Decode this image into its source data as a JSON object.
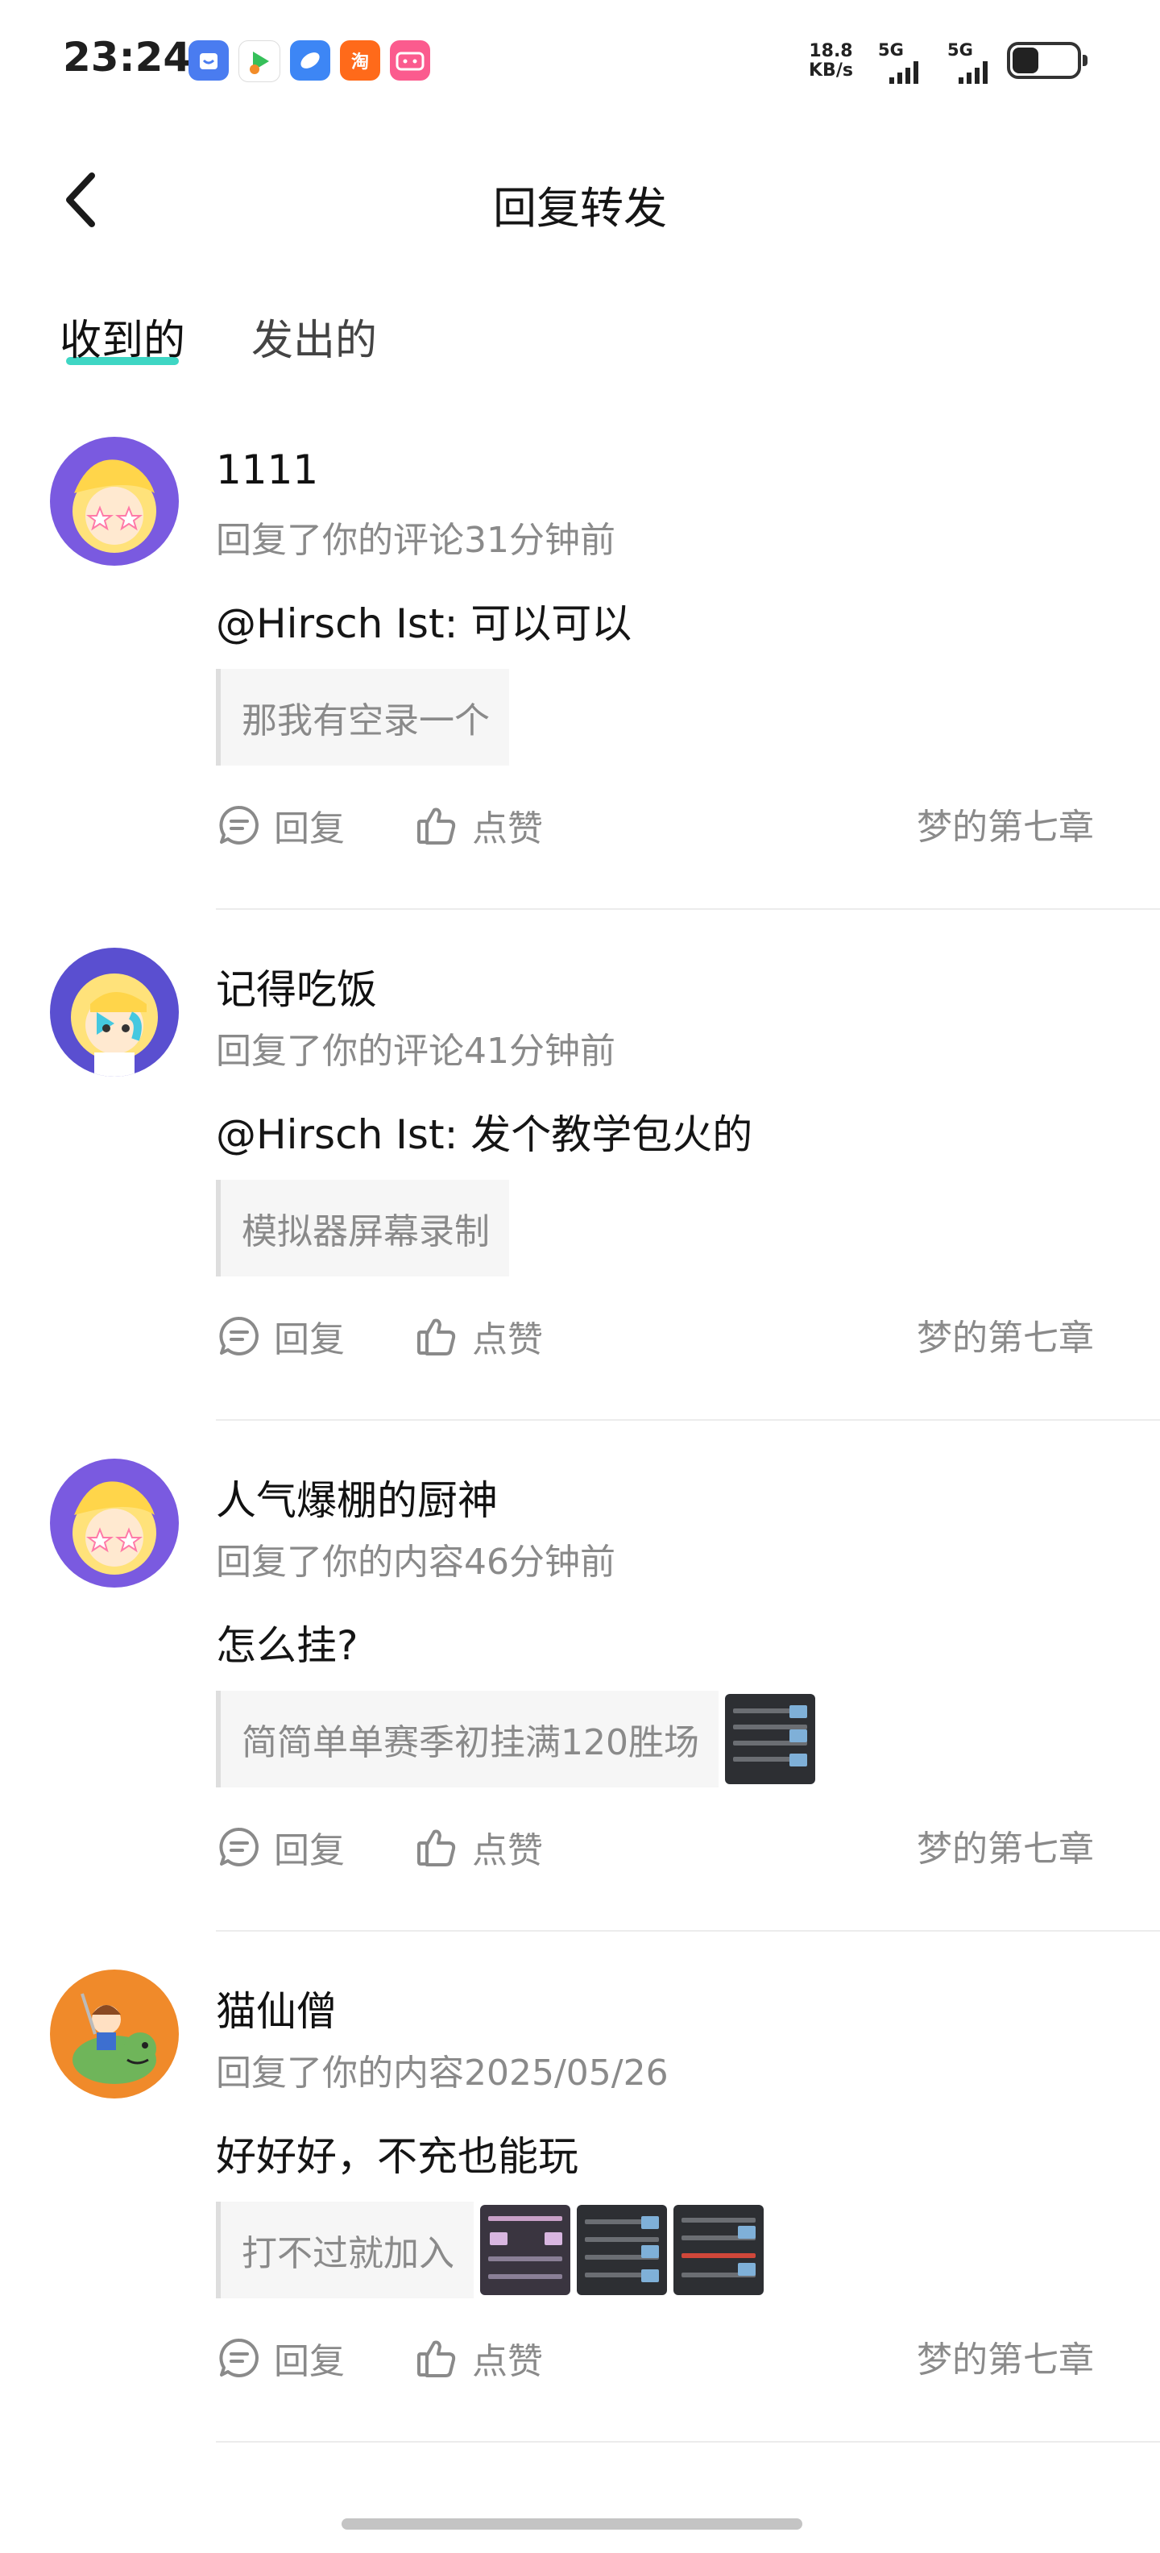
{
  "status_bar": {
    "time": "23:24",
    "net_speed_value": "18.8",
    "net_speed_unit": "KB/s",
    "signal_1": "5G",
    "signal_2": "5G",
    "app_icons": [
      "calendar-app-icon",
      "video-app-icon",
      "browser-app-icon",
      "taobao-app-icon",
      "bilibili-app-icon"
    ],
    "taobao_glyph": "淘"
  },
  "header": {
    "title": "回复转发"
  },
  "tabs": [
    {
      "label": "收到的",
      "active": true
    },
    {
      "label": "发出的",
      "active": false
    }
  ],
  "items": [
    {
      "username": "1111",
      "meta": "回复了你的评论31分钟前",
      "comment": "@Hirsch Ist: 可以可以",
      "quote": "那我有空录一个",
      "thumbnails": 0,
      "reply_label": "回复",
      "like_label": "点赞",
      "source": "梦的第七章",
      "avatar": "anime-girl-star-eyes"
    },
    {
      "username": "记得吃饭",
      "meta": "回复了你的评论41分钟前",
      "comment": "@Hirsch Ist: 发个教学包火的",
      "quote": "模拟器屏幕录制",
      "thumbnails": 0,
      "reply_label": "回复",
      "like_label": "点赞",
      "source": "梦的第七章",
      "avatar": "anime-girl-blue-hair"
    },
    {
      "username": "人气爆棚的厨神",
      "meta": "回复了你的内容46分钟前",
      "comment": "怎么挂?",
      "quote": "简简单单赛季初挂满120胜场",
      "thumbnails": 1,
      "reply_label": "回复",
      "like_label": "点赞",
      "source": "梦的第七章",
      "avatar": "anime-girl-star-eyes"
    },
    {
      "username": "猫仙僧",
      "meta": "回复了你的内容2025/05/26",
      "comment": "好好好，不充也能玩",
      "quote": "打不过就加入",
      "thumbnails": 3,
      "reply_label": "回复",
      "like_label": "点赞",
      "source": "梦的第七章",
      "avatar": "cartoon-rider-dinosaur"
    }
  ],
  "colors": {
    "accent_underline": "#3fd6c4",
    "secondary_text": "#8a8a8a",
    "quote_bg": "#f6f6f6"
  }
}
